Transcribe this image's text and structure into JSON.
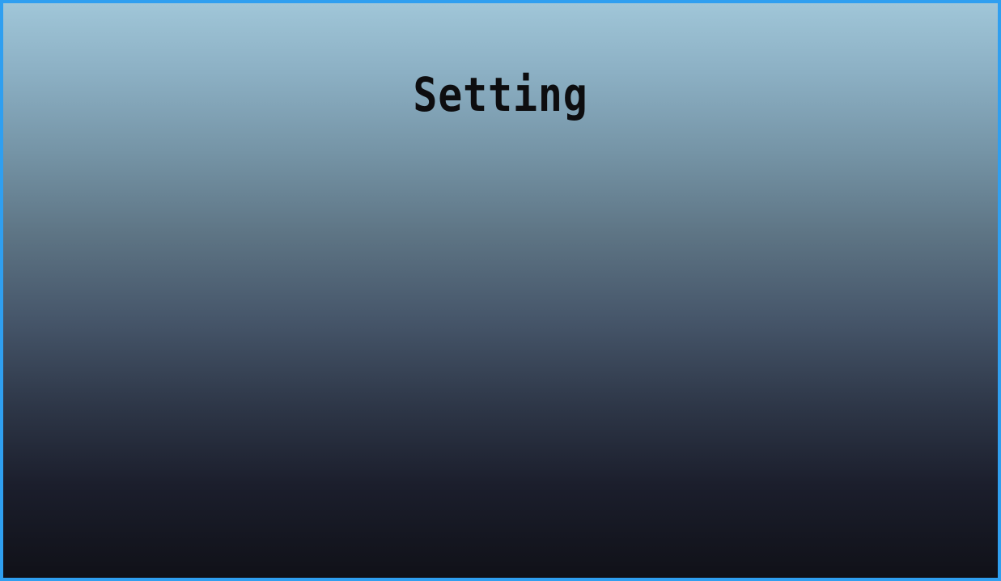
{
  "screen": {
    "title": "Setting"
  },
  "colors": {
    "border": "#2f9ff0",
    "gradient_top": "#a0c6d8",
    "gradient_bottom": "#101118",
    "title_text": "#0d0d0f"
  }
}
